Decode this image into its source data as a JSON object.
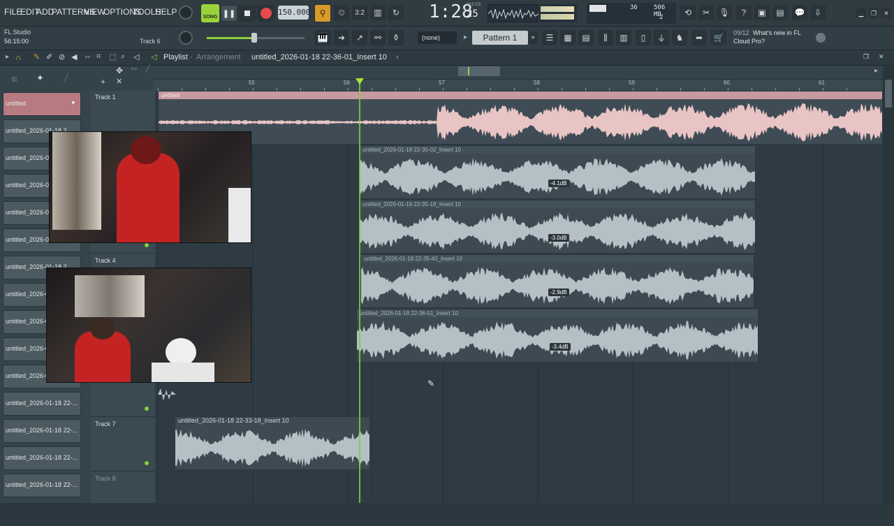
{
  "menu": [
    "FILE",
    "EDIT",
    "ADD",
    "PATTERNS",
    "VIEW",
    "OPTIONS",
    "TOOLS",
    "HELP"
  ],
  "transport": {
    "song_label": "SONG",
    "tempo": "150.000",
    "time": "1:28",
    "time_sub": "25",
    "time_unit": "M:S:CS"
  },
  "cpu": {
    "voices": "36",
    "memory": "506 MB",
    "polyphony": "2"
  },
  "hint": {
    "app": "FL Studio",
    "time": "56:15:00",
    "track": "Track 6"
  },
  "row2": {
    "pattern_select": "(none)",
    "pattern_name": "Pattern 1",
    "news_count": "09/12",
    "news_text_1": "What's new in FL",
    "news_text_2": "Cloud Pro?"
  },
  "playlist": {
    "title": "Playlist",
    "subtitle": "Arrangement",
    "breadcrumb": "untitled_2026-01-18 22-36-01_Insert 10",
    "sep": "›"
  },
  "ruler": [
    "55",
    "56",
    "57",
    "58",
    "59",
    "60",
    "61"
  ],
  "channels": [
    "untitled",
    "untitled_2026-01-18 2...",
    "untitled_2026-0",
    "untitled_2026-0",
    "untitled_2026-0",
    "untitled_2026-0",
    "untitled_2026-01-18 2...",
    "untitled_2026-0",
    "untitled_2026-0",
    "untitled_2026-0",
    "untitled_2026-0",
    "untitled_2026-01-18 22-...",
    "untitled_2026-01-18 22-...",
    "untitled_2026-01-18 22-...",
    "untitled_2026-01-18 22-..."
  ],
  "tracks": [
    "Track 1",
    "",
    "",
    "Track 4",
    "",
    "",
    "Track 7",
    "Track 8"
  ],
  "clips": [
    {
      "name": "untitled",
      "db": ""
    },
    {
      "name": "untitled_2026-01-18 22-35-02_Insert 10",
      "db": "-4.1dB"
    },
    {
      "name": "untitled_2026-01-18 22-35-18_Insert 10",
      "db": "-3.0dB"
    },
    {
      "name": "untitled_2026-01-18 22-35-40_Insert 10",
      "db": "-2.9dB"
    },
    {
      "name": "untitled_2026-01-18 22-36-01_Insert 10",
      "db": "-3.4dB"
    },
    {
      "name": "untitled_2026-01-18 22-33-18_Insert 10",
      "db": ""
    }
  ],
  "colors": {
    "accent": "#7ad23b",
    "clip_pink": "#e8c4c4",
    "wave_gray": "#b4c0c5"
  }
}
